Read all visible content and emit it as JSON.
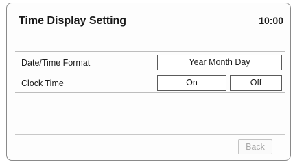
{
  "header": {
    "title": "Time Display Setting",
    "clock": "10:00"
  },
  "settings": {
    "date_time_format": {
      "label": "Date/Time Format",
      "value": "Year Month Day"
    },
    "clock_time": {
      "label": "Clock Time",
      "on_label": "On",
      "off_label": "Off"
    }
  },
  "footer": {
    "back_label": "Back"
  },
  "colors": {
    "frame": "#8a8a8a",
    "divider": "#bdbdbd",
    "button_border": "#5a5a5a",
    "disabled_text": "#a8a8a8"
  }
}
